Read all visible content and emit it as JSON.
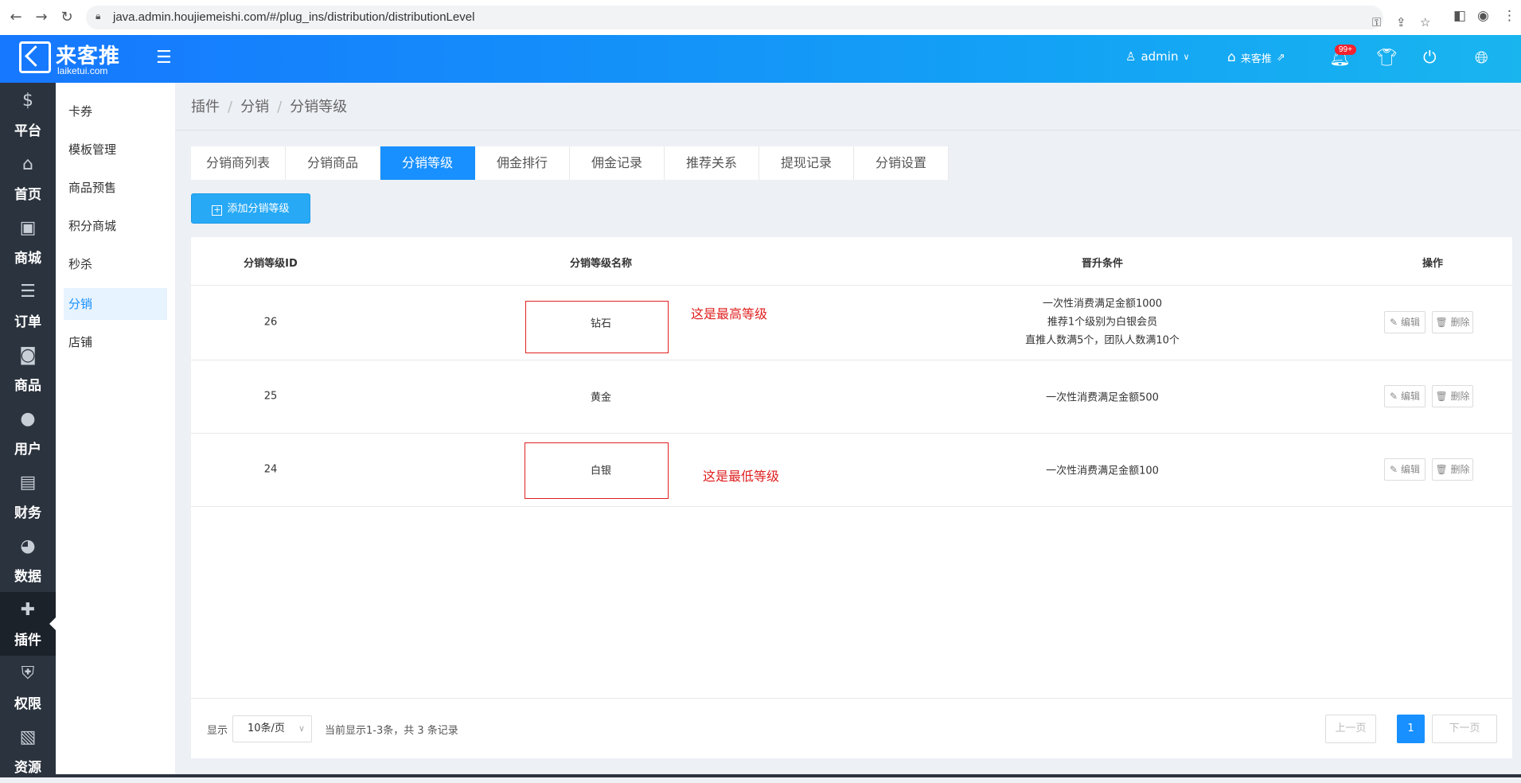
{
  "browser": {
    "url": "java.admin.houjiemeishi.com/#/plug_ins/distribution/distributionLevel"
  },
  "header": {
    "logo_name": "来客推",
    "logo_sub": "laiketui.com",
    "user": "admin",
    "store": "来客推",
    "notif_badge": "99+"
  },
  "sidebar": {
    "items": [
      {
        "label": "平台",
        "icon": "dollar-icon",
        "glyph": "$"
      },
      {
        "label": "首页",
        "icon": "home-icon",
        "glyph": "⌂"
      },
      {
        "label": "商城",
        "icon": "store-icon",
        "glyph": "▣"
      },
      {
        "label": "订单",
        "icon": "clipboard-icon",
        "glyph": "☰"
      },
      {
        "label": "商品",
        "icon": "bag-icon",
        "glyph": "◙"
      },
      {
        "label": "用户",
        "icon": "user-icon",
        "glyph": "●"
      },
      {
        "label": "财务",
        "icon": "wallet-icon",
        "glyph": "▤"
      },
      {
        "label": "数据",
        "icon": "pie-chart-icon",
        "glyph": "◕"
      },
      {
        "label": "插件",
        "icon": "puzzle-icon",
        "glyph": "✚"
      },
      {
        "label": "权限",
        "icon": "shield-icon",
        "glyph": "⛨"
      },
      {
        "label": "资源",
        "icon": "image-icon",
        "glyph": "▧"
      }
    ]
  },
  "submenu": {
    "items": [
      "卡券",
      "模板管理",
      "商品预售",
      "积分商城",
      "秒杀",
      "分销",
      "店铺"
    ]
  },
  "breadcrumb": [
    "插件",
    "分销",
    "分销等级"
  ],
  "tabs": [
    "分销商列表",
    "分销商品",
    "分销等级",
    "佣金排行",
    "佣金记录",
    "推荐关系",
    "提现记录",
    "分销设置"
  ],
  "add_button": "添加分销等级",
  "table": {
    "headers": [
      "分销等级ID",
      "分销等级名称",
      "晋升条件",
      "操作"
    ],
    "rows": [
      {
        "id": "26",
        "name": "钻石",
        "conditions": [
          "一次性消费满足金额1000",
          "推荐1个级别为白银会员",
          "直推人数满5个，团队人数满10个"
        ]
      },
      {
        "id": "25",
        "name": "黄金",
        "conditions": [
          "一次性消费满足金额500"
        ]
      },
      {
        "id": "24",
        "name": "白银",
        "conditions": [
          "一次性消费满足金额100"
        ]
      }
    ],
    "edit_label": "编辑",
    "delete_label": "删除"
  },
  "annotations": {
    "highest": "这是最高等级",
    "lowest": "这是最低等级",
    "color": "#e02020"
  },
  "footer": {
    "show_label": "显示",
    "page_size": "10条/页",
    "summary": "当前显示1-3条，共 3 条记录",
    "prev": "上一页",
    "current_page": "1",
    "next": "下一页"
  },
  "colors": {
    "accent": "#1890ff",
    "sidebar_bg": "#2b333e"
  }
}
